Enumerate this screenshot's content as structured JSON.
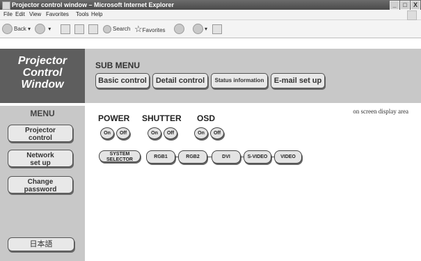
{
  "window": {
    "title": "Projector control window – Microsoft Internet Explorer",
    "buttons": [
      "_",
      "□",
      "X"
    ]
  },
  "menubar": [
    "File",
    "Edit",
    "View",
    "Favorites",
    "Tools",
    "Help"
  ],
  "toolbar": {
    "back": "Back",
    "search": "Search",
    "favorites": "Favorites"
  },
  "logo": [
    "Projector",
    "Control",
    "Window"
  ],
  "submenu": {
    "title": "SUB MENU",
    "buttons": [
      "Basic control",
      "Detail control",
      "Status information",
      "E-mail set up"
    ]
  },
  "menu": {
    "title": "MENU",
    "items": [
      {
        "line1": "Projector",
        "line2": "control"
      },
      {
        "line1": "Network",
        "line2": "set up"
      },
      {
        "line1": "Change",
        "line2": "password"
      }
    ],
    "language": "日本語"
  },
  "main": {
    "osd_area_label": "on screen display area",
    "groups": [
      {
        "label": "POWER",
        "on": "On",
        "off": "Off"
      },
      {
        "label": "SHUTTER",
        "on": "On",
        "off": "Off"
      },
      {
        "label": "OSD",
        "on": "On",
        "off": "Off"
      }
    ],
    "inputs": {
      "system_selector": [
        "SYSTEM",
        "SELECTOR"
      ],
      "sources": [
        "RGB1",
        "RGB2",
        "DVI",
        "S-VIDEO",
        "VIDEO"
      ]
    }
  }
}
